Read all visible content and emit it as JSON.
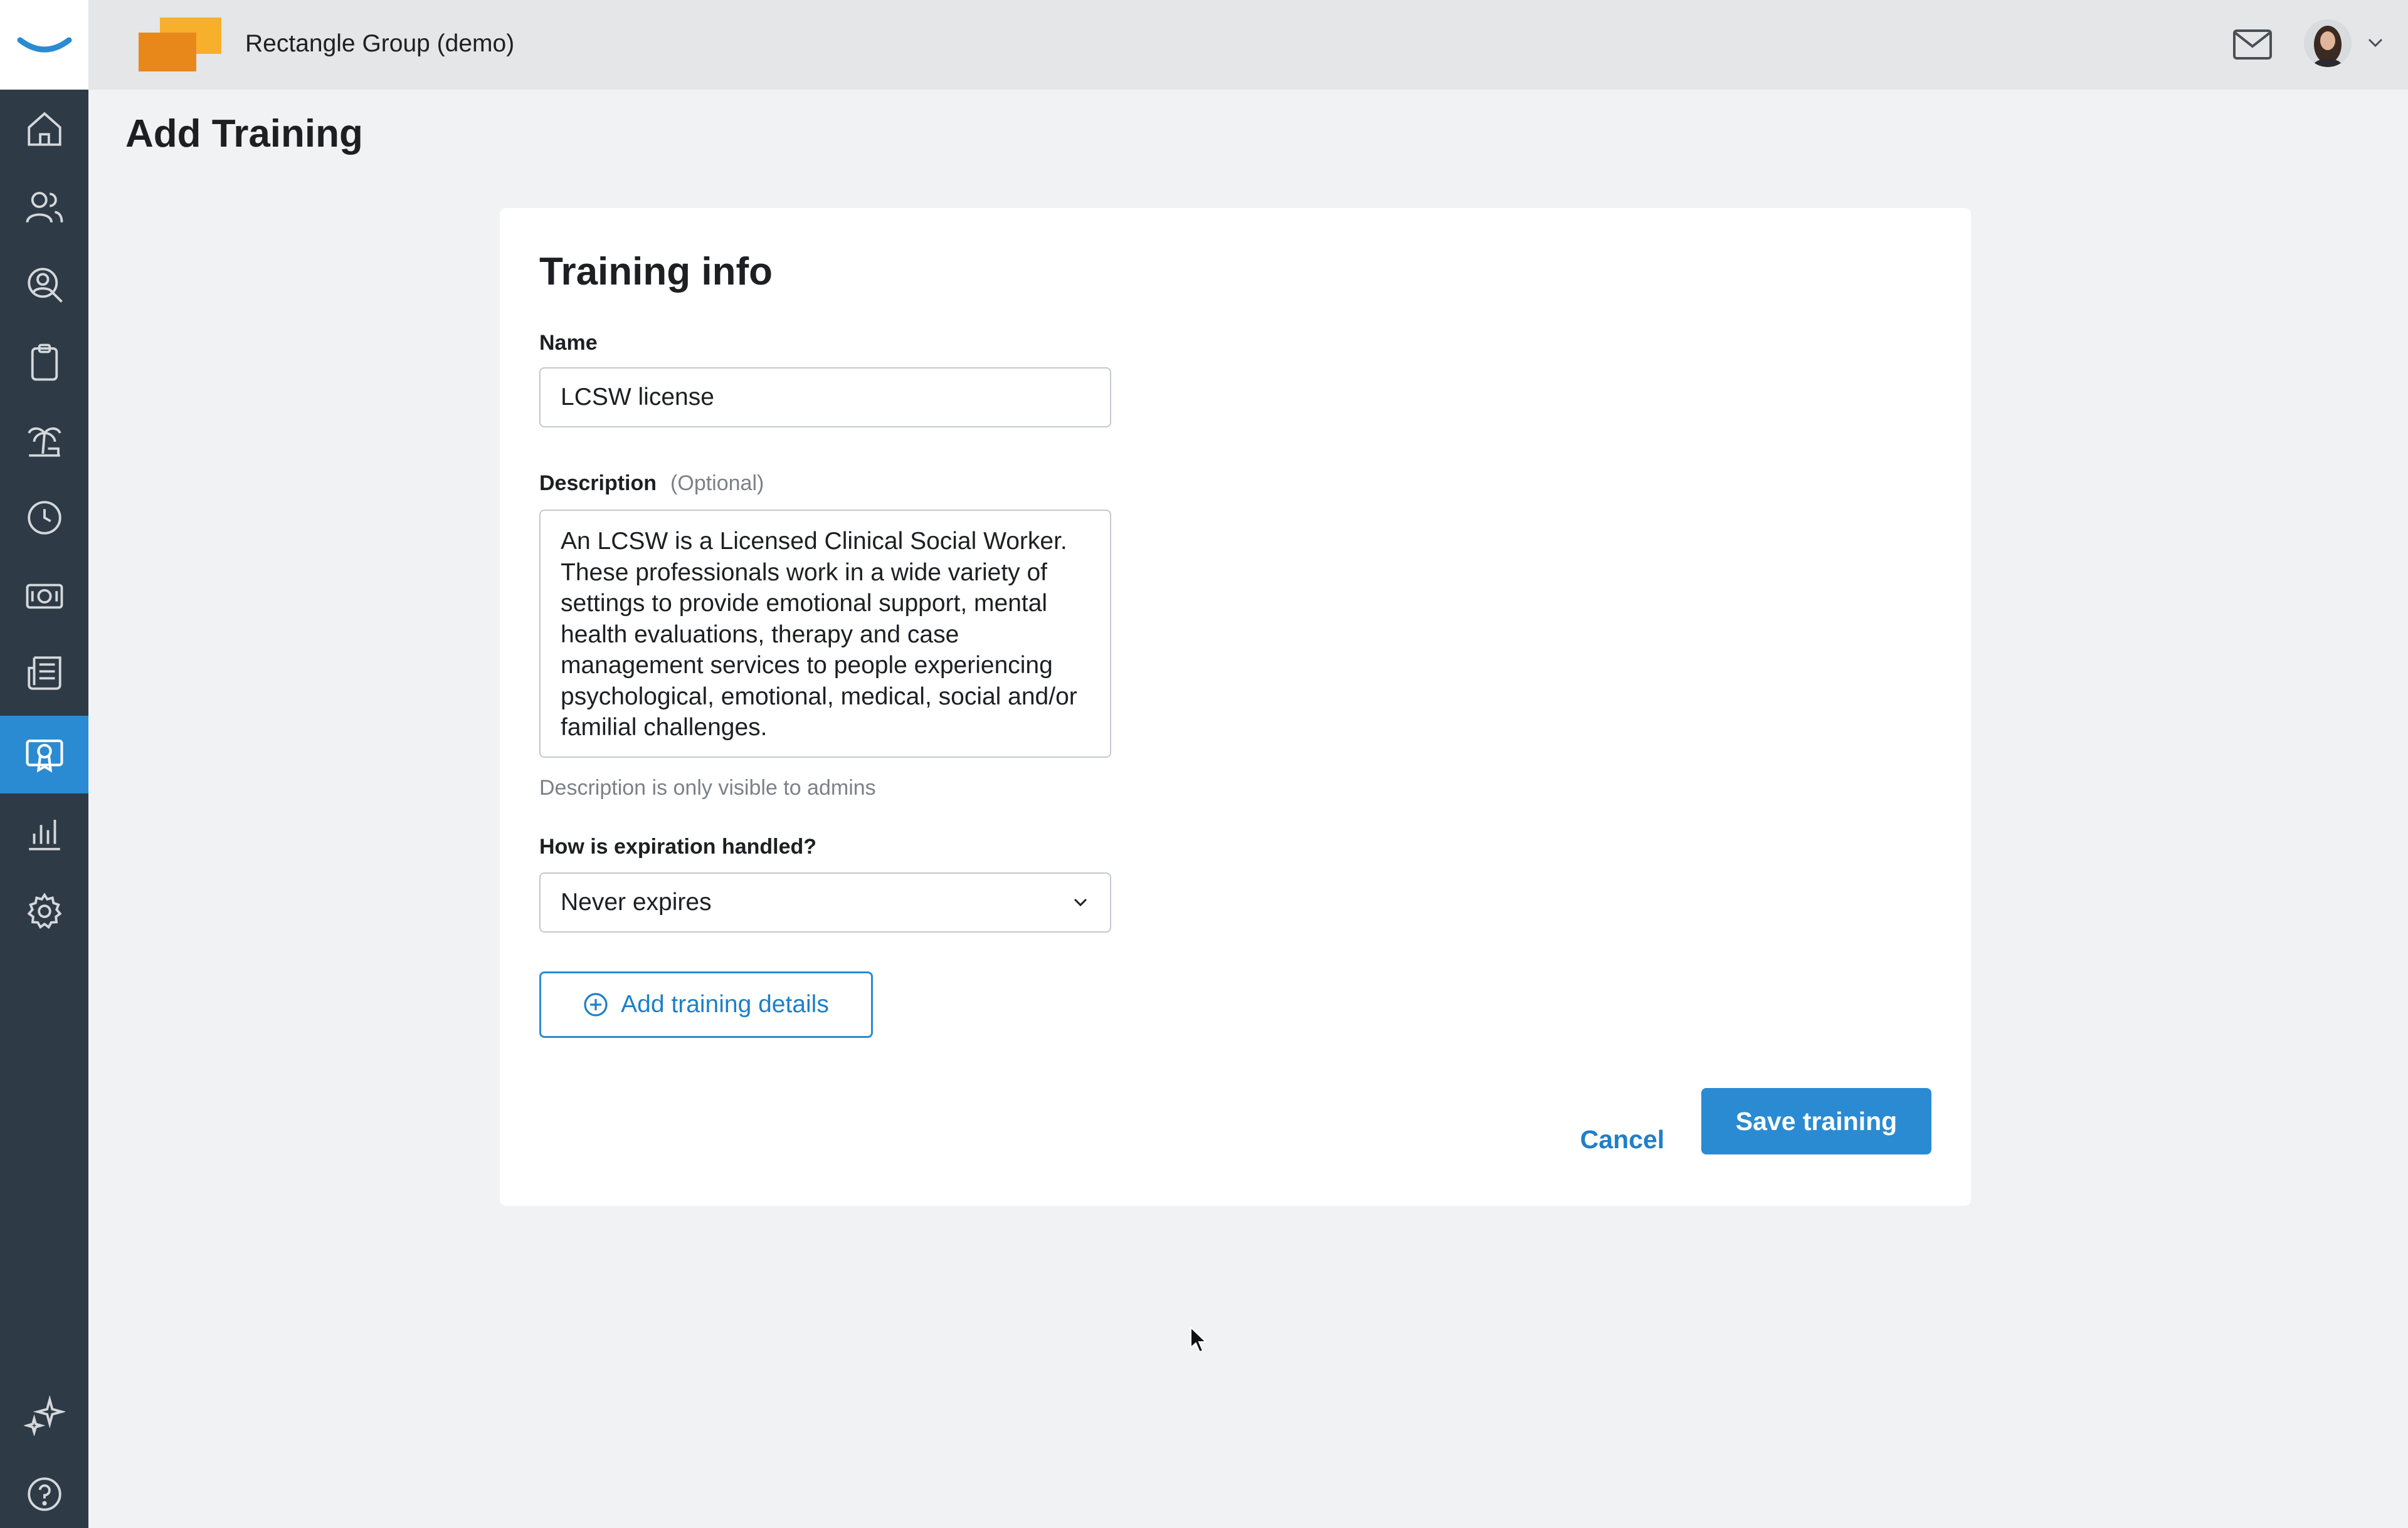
{
  "topbar": {
    "company_name": "Rectangle Group (demo)"
  },
  "sidebar": {
    "items": [
      {
        "icon": "home-icon"
      },
      {
        "icon": "people-icon"
      },
      {
        "icon": "person-search-icon"
      },
      {
        "icon": "clipboard-icon"
      },
      {
        "icon": "palm-tree-icon"
      },
      {
        "icon": "clock-icon"
      },
      {
        "icon": "money-icon"
      },
      {
        "icon": "newspaper-icon"
      },
      {
        "icon": "certificate-icon",
        "active": true
      },
      {
        "icon": "bar-chart-icon"
      },
      {
        "icon": "gear-icon"
      },
      {
        "icon": "sparkle-icon"
      },
      {
        "icon": "help-icon"
      }
    ]
  },
  "page": {
    "title": "Add Training"
  },
  "form": {
    "section_title": "Training info",
    "name_label": "Name",
    "name_value": "LCSW license",
    "description_label": "Description",
    "description_optional": "(Optional)",
    "description_value": "An LCSW is a Licensed Clinical Social Worker. These professionals work in a wide variety of settings to provide emotional support, mental health evaluations, therapy and case management services to people experiencing psychological, emotional, medical, social and/or familial challenges.",
    "description_hint": "Description is only visible to admins",
    "expiration_label": "How is expiration handled?",
    "expiration_value": "Never expires",
    "add_details_label": "Add training details",
    "cancel_label": "Cancel",
    "save_label": "Save training"
  },
  "colors": {
    "sidebar_bg": "#2e3a45",
    "accent": "#2a8bd2",
    "brand_orange": "#f29a1c"
  }
}
